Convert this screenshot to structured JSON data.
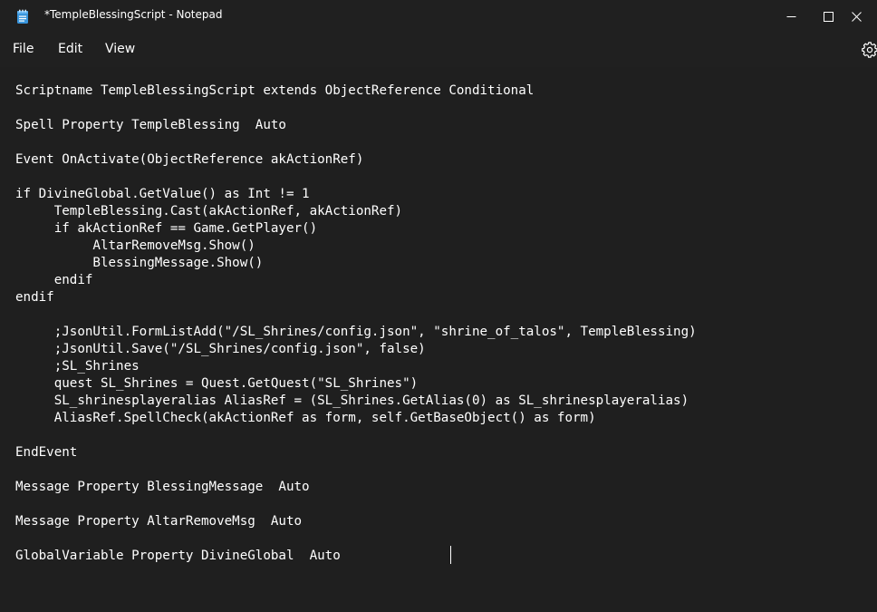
{
  "window": {
    "title": "*TempleBlessingScript - Notepad"
  },
  "icons": {
    "app": "notepad-icon",
    "minimize": "minimize-icon",
    "maximize": "maximize-icon",
    "close": "close-icon",
    "settings": "gear-icon"
  },
  "menubar": {
    "file": "File",
    "edit": "Edit",
    "view": "View"
  },
  "editor": {
    "content": "Scriptname TempleBlessingScript extends ObjectReference Conditional\n\nSpell Property TempleBlessing  Auto\n\nEvent OnActivate(ObjectReference akActionRef)\n\nif DivineGlobal.GetValue() as Int != 1\n     TempleBlessing.Cast(akActionRef, akActionRef)\n     if akActionRef == Game.GetPlayer()\n          AltarRemoveMsg.Show()\n          BlessingMessage.Show()\n     endif\nendif\n\n     ;JsonUtil.FormListAdd(\"/SL_Shrines/config.json\", \"shrine_of_talos\", TempleBlessing)\n     ;JsonUtil.Save(\"/SL_Shrines/config.json\", false)\n     ;SL_Shrines\n     quest SL_Shrines = Quest.GetQuest(\"SL_Shrines\")\n     SL_shrinesplayeralias AliasRef = (SL_Shrines.GetAlias(0) as SL_shrinesplayeralias)\n     AliasRef.SpellCheck(akActionRef as form, self.GetBaseObject() as form)\n\nEndEvent\n\nMessage Property BlessingMessage  Auto\n\nMessage Property AltarRemoveMsg  Auto\n\nGlobalVariable Property DivineGlobal  Auto"
  },
  "colors": {
    "background": "#1f1f1f",
    "titlebar": "#202020",
    "text": "#ffffff",
    "app_icon_blue": "#3a96dd"
  }
}
